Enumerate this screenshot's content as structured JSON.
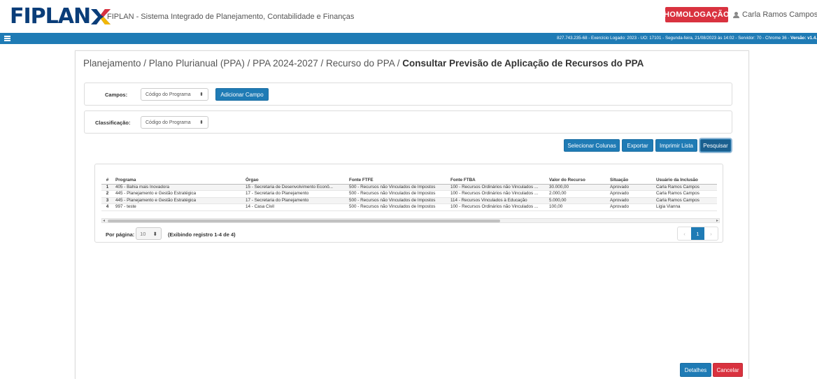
{
  "header": {
    "logo_text": "FIPLAN",
    "app_title": "FIPLAN - Sistema Integrado de Planejamento, Contabilidade e Finanças",
    "environment": "HOMOLOGAÇÃO",
    "user_name": "Carla Ramos Campos",
    "user_caret": "▾",
    "brand_color": "#0a3d79",
    "env_color": "#d9323f"
  },
  "infobar": {
    "session_text": "827.743.235-68 - Exercício Logado: 2023 - UO: 17101 - Segunda-feira, 21/08/2023 às 14:02 - Servidor: 70 - Chrome 36 - ",
    "version_label": "Versão: v1.4.",
    "bar_color": "#1f7bb5"
  },
  "breadcrumb": {
    "path": "Planejamento / Plano Plurianual (PPA) / PPA 2024-2027 / Recurso do PPA / ",
    "current": "Consultar Previsão de Aplicação de Recursos do PPA"
  },
  "filters": {
    "campos_label": "Campos:",
    "campos_value": "Código do Programa",
    "add_field_label": "Adicionar Campo",
    "classificacao_label": "Classificação:",
    "classificacao_value": "Código do Programa",
    "caret": "⬍"
  },
  "actions": {
    "select_columns": "Selecionar Colunas",
    "export": "Exportar",
    "print_list": "Imprimir Lista",
    "search": "Pesquisar"
  },
  "table": {
    "columns": [
      "#",
      "Programa",
      "Órgao",
      "Fonte FTFE",
      "Fonte FTBA",
      "Valor do Recurso",
      "Situação",
      "Usuário da Inclusão"
    ],
    "rows": [
      [
        "1",
        "405 - Bahia mais Inovadora",
        "15 - Secretaria de Desenvolvimento Econô...",
        "500 - Recursos não Vinculados de Impostos",
        "100 - Recursos Ordinários não Vinculados ...",
        "30.000,00",
        "Aprovado",
        "Carla Ramos Campos"
      ],
      [
        "2",
        "445 - Planejamento e Gestão Estratégica",
        "17 - Secretaria do Planejamento",
        "500 - Recursos não Vinculados de Impostos",
        "100 - Recursos Ordinários não Vinculados ...",
        "2.000,00",
        "Aprovado",
        "Carla Ramos Campos"
      ],
      [
        "3",
        "445 - Planejamento e Gestão Estratégica",
        "17 - Secretaria do Planejamento",
        "500 - Recursos não Vinculados de Impostos",
        "114 - Recursos Vinculados à Educação",
        "5.000,00",
        "Aprovado",
        "Carla Ramos Campos"
      ],
      [
        "4",
        "997 - teste",
        "14 - Casa Civil",
        "500 - Recursos não Vinculados de Impostos",
        "100 - Recursos Ordinários não Vinculados ...",
        "100,00",
        "Aprovado",
        "Ligia Vianna"
      ]
    ]
  },
  "pagination": {
    "per_page_label": "Por página:",
    "per_page_value": "10",
    "record_info": "(Exibindo registro 1-4 de 4)",
    "prev": "‹",
    "current_page": "1",
    "next": "›"
  },
  "footer": {
    "details": "Detalhes",
    "cancel": "Cancelar"
  }
}
